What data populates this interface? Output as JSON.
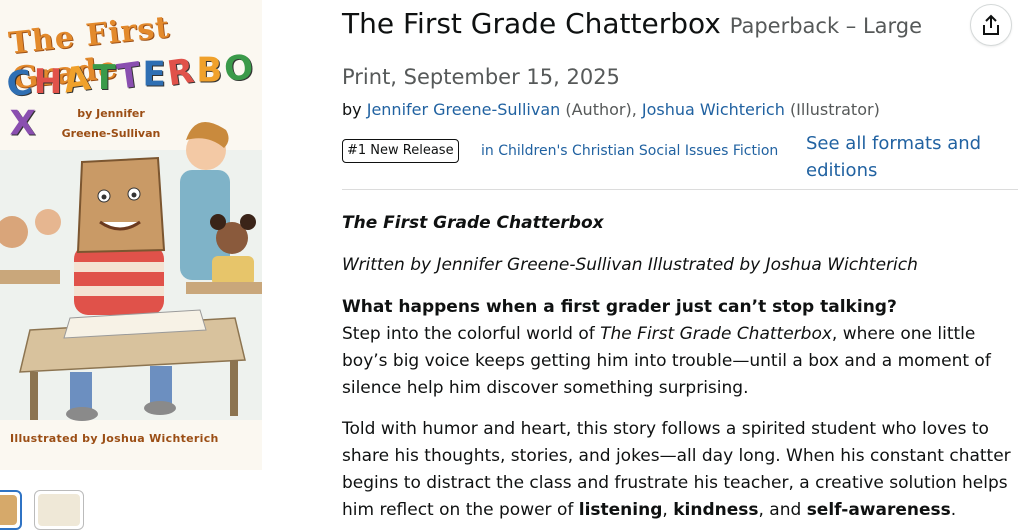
{
  "cover": {
    "title_top": "The First Grade",
    "title_main": "CHATTERBOX",
    "author_line1": "by Jennifer",
    "author_line2": "Greene-Sullivan",
    "illustrator": "Illustrated by Joshua Wichterich"
  },
  "share": {
    "icon": "share-icon"
  },
  "product": {
    "title": "The First Grade Chatterbox",
    "format": "Paperback – Large",
    "format_cont": "Print, September 15, 2025",
    "by": "by",
    "author": "Jennifer Greene-Sullivan",
    "author_role": "(Author),",
    "illustrator": "Joshua Wichterich",
    "illustrator_role": "(Illustrator)",
    "badge": "#1 New Release",
    "badge_category": "in Children's Christian Social Issues Fiction",
    "formats_link": "See all formats and editions"
  },
  "description": {
    "book_title": "The First Grade Chatterbox",
    "credits": "Written by Jennifer Greene-Sullivan Illustrated by Joshua Wichterich",
    "question": "What happens when a first grader just can’t stop talking?",
    "p1_before": "Step into the colorful world of ",
    "p1_title": "The First Grade Chatterbox",
    "p1_after": ", where one little boy’s big voice keeps getting him into trouble—until a box and a moment of silence help him discover something surprising.",
    "p2_text": "Told with humor and heart, this story follows a spirited student who loves to share his thoughts, stories, and jokes—all day long. When his constant chatter begins to distract the class and frustrate his teacher, a creative solution helps him reflect on the power of ",
    "p2_b1": "listening",
    "p2_sep1": ", ",
    "p2_b2": "kindness",
    "p2_sep2": ", and ",
    "p2_b3": "self-awareness",
    "p2_end": "."
  }
}
